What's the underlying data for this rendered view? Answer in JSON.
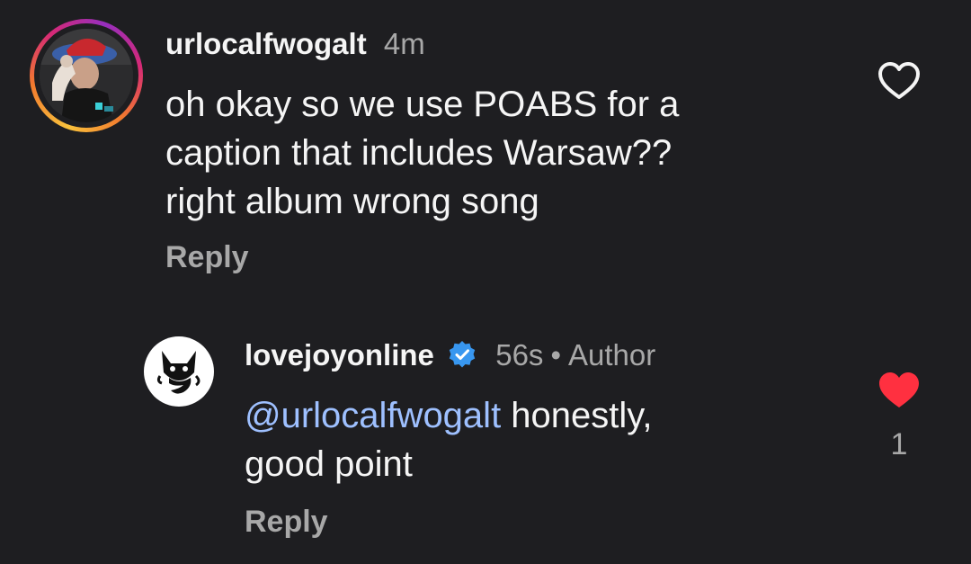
{
  "comments": [
    {
      "username": "urlocalfwogalt",
      "time": "4m",
      "lines": [
        "oh okay so we use POABS for a",
        "caption that includes Warsaw??",
        "right album wrong song"
      ],
      "reply_label": "Reply",
      "liked": false,
      "like_icon": "heart-outline-icon"
    }
  ],
  "reply": {
    "username": "lovejoyonline",
    "verified_icon": "verified-badge-icon",
    "time": "56s",
    "separator": "•",
    "author_label": "Author",
    "mention": "@urlocalfwogalt",
    "text_after_mention": " honestly,",
    "line2": "good point",
    "reply_label": "Reply",
    "liked": true,
    "like_icon": "heart-filled-icon",
    "like_count": "1",
    "like_color": "#ff3040"
  },
  "colors": {
    "background": "#1e1e21",
    "text": "#f5f5f5",
    "secondary_text": "#a8a8a8",
    "mention": "#9ec0ff",
    "verified": "#3897f0"
  }
}
